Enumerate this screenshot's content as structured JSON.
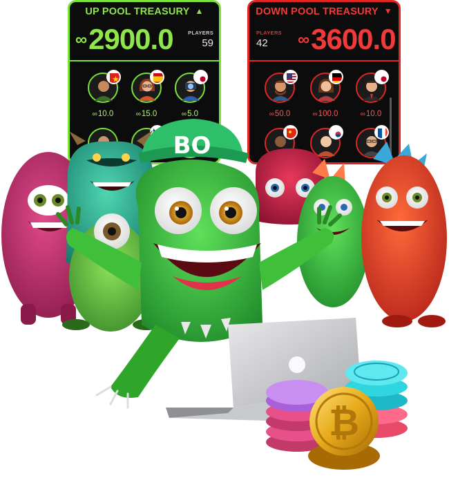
{
  "up_pool": {
    "title": "UP POOL TREASURY",
    "amount": "2900.0",
    "players_label": "PLAYERS",
    "players_count": "59",
    "bets": [
      {
        "amount": "10.0",
        "flag": "vietnam-flag-icon"
      },
      {
        "amount": "15.0",
        "flag": "spain-flag-icon"
      },
      {
        "amount": "5.0",
        "flag": "japan-flag-icon"
      }
    ],
    "accent": "#7be23a"
  },
  "down_pool": {
    "title": "DOWN POOL TREASURY",
    "amount": "3600.0",
    "players_label": "PLAYERS",
    "players_count": "42",
    "bets": [
      {
        "amount": "50.0",
        "flag": "usa-flag-icon"
      },
      {
        "amount": "100.0",
        "flag": "germany-flag-icon"
      },
      {
        "amount": "10.0",
        "flag": "japan-flag-icon"
      }
    ],
    "accent": "#e22525"
  },
  "symbols": {
    "infinity": "∞",
    "up_arrow": "▲",
    "down_arrow": "▼"
  },
  "mascot": {
    "cap_text": "BO"
  }
}
